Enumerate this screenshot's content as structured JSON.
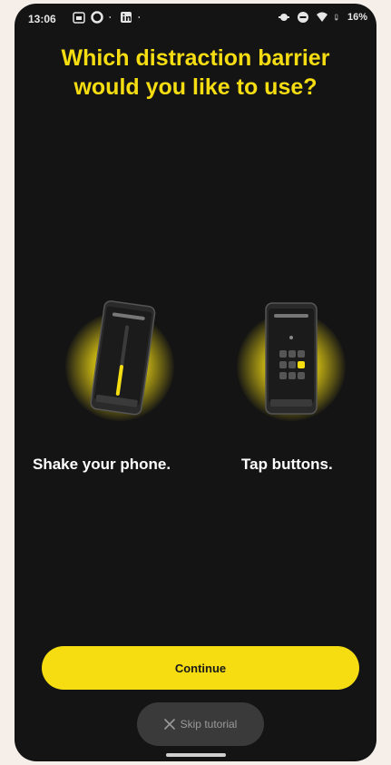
{
  "status_bar": {
    "time": "13:06",
    "battery_text": "16%"
  },
  "screen": {
    "title": "Which distraction barrier would you like to use?"
  },
  "options": [
    {
      "label": "Shake your phone.",
      "icon": "phone-shake-illustration"
    },
    {
      "label": "Tap buttons.",
      "icon": "phone-tap-illustration"
    }
  ],
  "actions": {
    "continue_label": "Continue",
    "skip_label": "Skip tutorial"
  },
  "colors": {
    "accent": "#f5dd12",
    "background": "#141414",
    "skip_bg": "#3a3a3a"
  }
}
